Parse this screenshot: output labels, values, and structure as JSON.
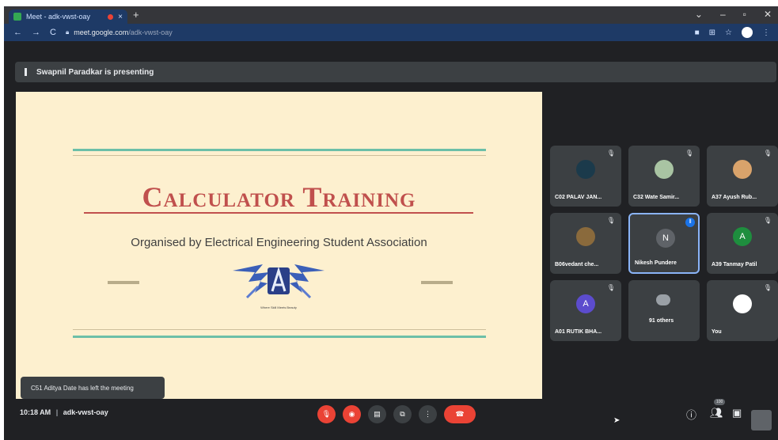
{
  "browser": {
    "tab_title": "Meet - adk-vwst-oay",
    "url_host": "meet.google.com",
    "url_path": "/adk-vwst-oay"
  },
  "meeting": {
    "presenting_text": "Swapnil Paradkar is presenting",
    "code": "adk-vwst-oay",
    "time": "10:18 AM",
    "separator": "|",
    "toast": "C51 Aditya Date has left the meeting",
    "participant_badge": "100"
  },
  "slide": {
    "title": "Calculator Training",
    "subtitle": "Organised by Electrical Engineering Student Association",
    "logo_caption": "Where Skill Meets Beauty"
  },
  "tiles": [
    {
      "name": "C02 PALAV JAN...",
      "avatar": "",
      "avatar_color": "#1b3a4b"
    },
    {
      "name": "C32 Wate Samir...",
      "avatar": "",
      "avatar_color": "#a9c4a3"
    },
    {
      "name": "A37 Ayush Rub...",
      "avatar": "",
      "avatar_color": "#d9a36b"
    },
    {
      "name": "B06vedant che...",
      "avatar": "",
      "avatar_color": "#8a6a3c"
    },
    {
      "name": "Nikesh Pundere",
      "avatar": "N",
      "avatar_color": "#5f6368"
    },
    {
      "name": "A39 Tanmay Patil",
      "avatar": "A",
      "avatar_color": "#1e8e3e"
    },
    {
      "name": "A01 RUTIK BHA...",
      "avatar": "A",
      "avatar_color": "#5c4ccd"
    },
    {
      "name": "91 others",
      "avatar": "",
      "avatar_color": "#9aa0a6"
    },
    {
      "name": "You",
      "avatar": "",
      "avatar_color": "#ffffff"
    }
  ],
  "colors": {
    "end_call": "#ea4335",
    "slide_bg": "#fdf0cf",
    "title_red": "#c0504d",
    "rule_teal": "#6cbfa8",
    "active_border": "#8ab4f8"
  },
  "icons": {
    "mic_off": "mic-off-icon",
    "cam_off": "camera-off-icon",
    "captions": "captions-icon",
    "present": "present-icon",
    "more": "more-options-icon",
    "end": "end-call-icon",
    "info": "info-icon",
    "people": "people-icon",
    "chat": "chat-icon"
  }
}
